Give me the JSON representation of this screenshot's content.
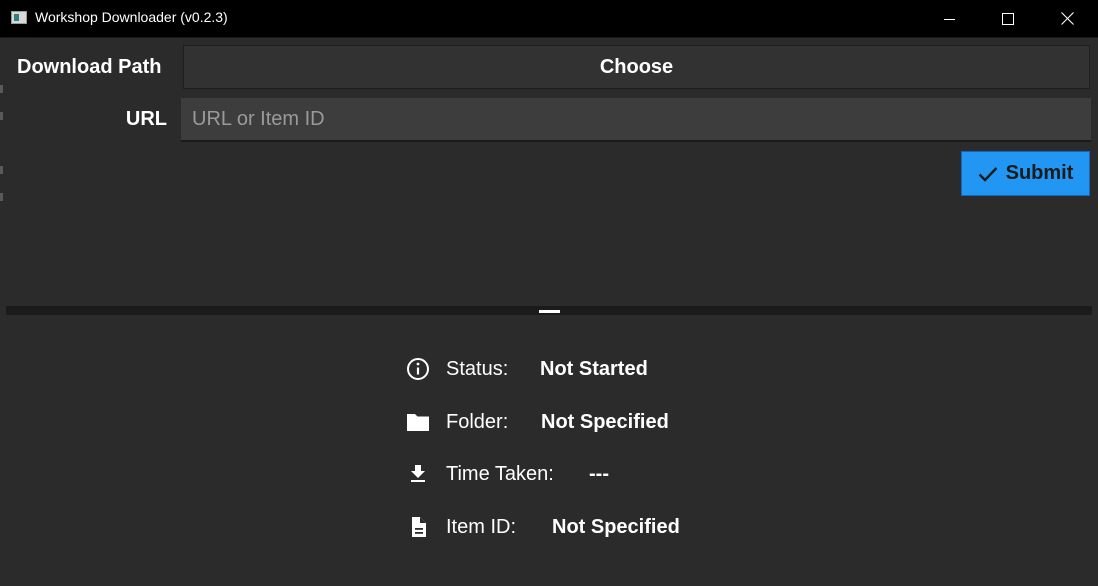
{
  "window": {
    "title": "Workshop Downloader (v0.2.3)",
    "minimize_icon": "minimize-icon",
    "maximize_icon": "maximize-icon",
    "close_icon": "close-icon"
  },
  "form": {
    "download_path_label": "Download Path",
    "choose_label": "Choose",
    "url_label": "URL",
    "url_value": "",
    "url_placeholder": "URL or Item ID",
    "submit_label": "Submit",
    "submit_icon": "check-icon",
    "submit_color": "#2196f3"
  },
  "status": {
    "items": [
      {
        "icon": "info-icon",
        "label": "Status:",
        "value": "Not Started"
      },
      {
        "icon": "folder-icon",
        "label": "Folder:",
        "value": "Not Specified"
      },
      {
        "icon": "download-icon",
        "label": "Time Taken:",
        "value": "---"
      },
      {
        "icon": "document-icon",
        "label": "Item ID:",
        "value": "Not Specified"
      }
    ]
  }
}
